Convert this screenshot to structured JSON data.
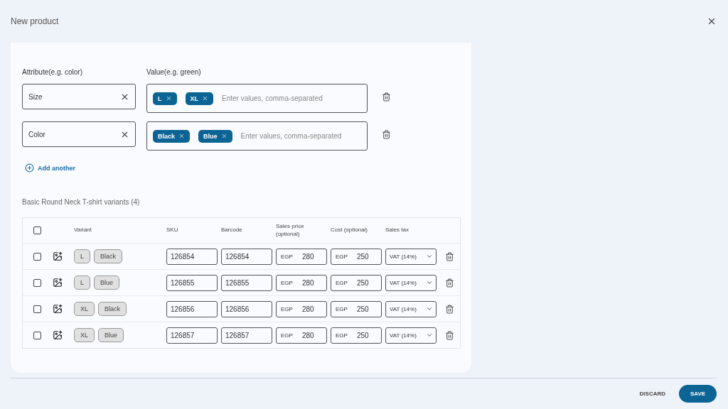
{
  "title": "New product",
  "attributes": {
    "attribute_label": "Attribute(e.g. color)",
    "value_label": "Value(e.g. green)",
    "rows": [
      {
        "name": "Size",
        "chips": [
          "L",
          "XL"
        ],
        "placeholder": "Enter values, comma-separated"
      },
      {
        "name": "Color",
        "chips": [
          "Black",
          "Blue"
        ],
        "placeholder": "Enter values, comma-separated"
      }
    ],
    "add_link": "Add another"
  },
  "variants_title": "Basic Round Neck T-shirt variants (4)",
  "table": {
    "all_checked": false,
    "columns": [
      "Variant",
      "SKU",
      "Barcode",
      "Sales price (optional)",
      "Cost (optional)",
      "Sales tax"
    ],
    "rows": [
      {
        "checked": false,
        "tags": [
          "L",
          "Black"
        ],
        "sku": "126854",
        "barcode": "126854",
        "price_currency": "EGP",
        "price": "280",
        "cost_currency": "EGP",
        "cost": "250",
        "tax": "VAT (14%)"
      },
      {
        "checked": false,
        "tags": [
          "L",
          "Blue"
        ],
        "sku": "126855",
        "barcode": "126855",
        "price_currency": "EGP",
        "price": "280",
        "cost_currency": "EGP",
        "cost": "250",
        "tax": "VAT (14%)"
      },
      {
        "checked": false,
        "tags": [
          "XL",
          "Black"
        ],
        "sku": "126856",
        "barcode": "126856",
        "price_currency": "EGP",
        "price": "280",
        "cost_currency": "EGP",
        "cost": "250",
        "tax": "VAT (14%)"
      },
      {
        "checked": false,
        "tags": [
          "XL",
          "Blue"
        ],
        "sku": "126857",
        "barcode": "126857",
        "price_currency": "EGP",
        "price": "280",
        "cost_currency": "EGP",
        "cost": "250",
        "tax": "VAT (14%)"
      }
    ]
  },
  "footer": {
    "discard": "DISCARD",
    "save": "SAVE"
  }
}
